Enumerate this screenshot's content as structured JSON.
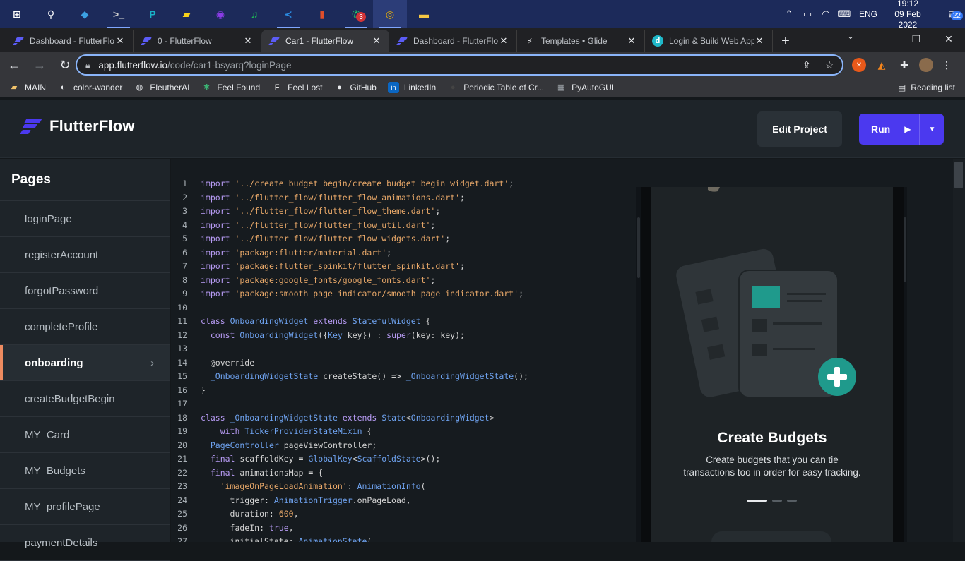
{
  "taskbar": {
    "apps": [
      {
        "name": "windows-start-icon",
        "glyph": "⊞",
        "color": "#ffffff"
      },
      {
        "name": "search-icon",
        "glyph": "⚲",
        "color": "#ffffff"
      },
      {
        "name": "git-app-icon",
        "glyph": "◆",
        "color": "#3ca1e3"
      },
      {
        "name": "terminal-icon",
        "glyph": ">_",
        "color": "#cccccc"
      },
      {
        "name": "pycharm-icon",
        "glyph": "P",
        "color": "#19b2c7"
      },
      {
        "name": "sticky-notes-icon",
        "glyph": "▰",
        "color": "#f8d21a"
      },
      {
        "name": "podcast-app-icon",
        "glyph": "◉",
        "color": "#8a3ce6"
      },
      {
        "name": "spotify-icon",
        "glyph": "♫",
        "color": "#1db954"
      },
      {
        "name": "vscode-icon",
        "glyph": "≺",
        "color": "#2a8ae0"
      },
      {
        "name": "office-app-icon",
        "glyph": "▮",
        "color": "#e04e2b"
      },
      {
        "name": "whatsapp-icon",
        "glyph": "✆",
        "color": "#25d366",
        "badge": "3"
      },
      {
        "name": "chrome-icon",
        "glyph": "◎",
        "color": "#f0b400"
      },
      {
        "name": "file-explorer-icon",
        "glyph": "▬",
        "color": "#f5c744"
      }
    ],
    "tray": {
      "language": "ENG",
      "time": "19:12",
      "date": "09 Feb 2022",
      "notifications": "22"
    }
  },
  "browser": {
    "tabs": [
      {
        "title": "Dashboard - FlutterFlow",
        "fav": "ff"
      },
      {
        "title": "0 - FlutterFlow",
        "fav": "ff"
      },
      {
        "title": "Car1 - FlutterFlow",
        "fav": "ff",
        "active": true
      },
      {
        "title": "Dashboard - FlutterFlow",
        "fav": "ff"
      },
      {
        "title": "Templates • Glide",
        "fav": "glide"
      },
      {
        "title": "Login & Build Web Apps",
        "fav": "d"
      }
    ],
    "new_tab_label": "+",
    "url_host": "app.flutterflow.io",
    "url_path": "/code/car1-bsyarq?loginPage",
    "bookmarks": [
      {
        "label": "MAIN",
        "icon": "folder-icon",
        "color": "#f2c36b"
      },
      {
        "label": "color-wander",
        "icon": "globe-icon",
        "color": "#e8eaed"
      },
      {
        "label": "EleutherAI",
        "icon": "eleuther-icon",
        "color": "#e8eaed"
      },
      {
        "label": "Feel Found",
        "icon": "feelfound-icon",
        "color": "#3bb273"
      },
      {
        "label": "Feel Lost",
        "icon": "feellost-icon",
        "color": "#ffffff"
      },
      {
        "label": "GitHub",
        "icon": "github-icon",
        "color": "#e8eaed"
      },
      {
        "label": "LinkedIn",
        "icon": "linkedin-icon",
        "color": "#0a66c2"
      },
      {
        "label": "Periodic Table of Cr...",
        "icon": "periodic-icon",
        "color": "#444"
      },
      {
        "label": "PyAutoGUI",
        "icon": "doc-icon",
        "color": "#9aa0a6"
      }
    ],
    "reading_list": "Reading list"
  },
  "app": {
    "brand": "FlutterFlow",
    "edit_project": "Edit Project",
    "run": "Run",
    "pages_title": "Pages",
    "pages": [
      "loginPage",
      "registerAccount",
      "forgotPassword",
      "completeProfile",
      "onboarding",
      "createBudgetBegin",
      "MY_Card",
      "MY_Budgets",
      "MY_profilePage",
      "paymentDetails"
    ],
    "active_page": "onboarding",
    "accent": "#4b39ef",
    "active_marker": "#ee8b60"
  },
  "code_lines": [
    "import '../create_budget_begin/create_budget_begin_widget.dart';",
    "import '../flutter_flow/flutter_flow_animations.dart';",
    "import '../flutter_flow/flutter_flow_theme.dart';",
    "import '../flutter_flow/flutter_flow_util.dart';",
    "import '../flutter_flow/flutter_flow_widgets.dart';",
    "import 'package:flutter/material.dart';",
    "import 'package:flutter_spinkit/flutter_spinkit.dart';",
    "import 'package:google_fonts/google_fonts.dart';",
    "import 'package:smooth_page_indicator/smooth_page_indicator.dart';",
    "",
    "class OnboardingWidget extends StatefulWidget {",
    "  const OnboardingWidget({Key key}) : super(key: key);",
    "",
    "  @override",
    "  _OnboardingWidgetState createState() => _OnboardingWidgetState();",
    "}",
    "",
    "class _OnboardingWidgetState extends State<OnboardingWidget>",
    "    with TickerProviderStateMixin {",
    "  PageController pageViewController;",
    "  final scaffoldKey = GlobalKey<ScaffoldState>();",
    "  final animationsMap = {",
    "    'imageOnPageLoadAnimation': AnimationInfo(",
    "      trigger: AnimationTrigger.onPageLoad,",
    "      duration: 600,",
    "      fadeIn: true,",
    "      initialState: AnimationState("
  ],
  "preview": {
    "title": "Create Budgets",
    "body_line1": "Create budgets that you can tie",
    "body_line2": "transactions too in order for easy tracking.",
    "page_index": 1,
    "page_count": 3
  }
}
